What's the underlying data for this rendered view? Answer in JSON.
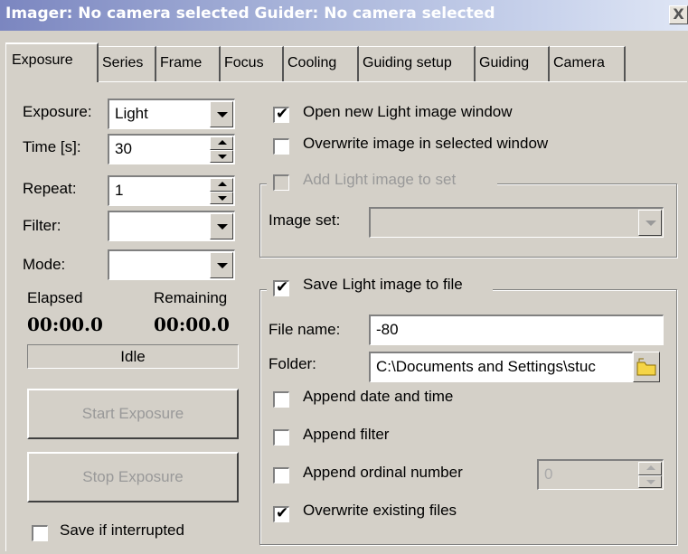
{
  "window": {
    "title": "Imager: No camera selected Guider: No camera selected",
    "close_glyph": "X"
  },
  "tabs": [
    {
      "label": "Exposure",
      "active": true
    },
    {
      "label": "Series"
    },
    {
      "label": "Frame"
    },
    {
      "label": "Focus"
    },
    {
      "label": "Cooling"
    },
    {
      "label": "Guiding setup"
    },
    {
      "label": "Guiding"
    },
    {
      "label": "Camera"
    }
  ],
  "left": {
    "exposure": {
      "label": "Exposure:",
      "value": "Light"
    },
    "time": {
      "label": "Time [s]:",
      "value": "30"
    },
    "repeat": {
      "label": "Repeat:",
      "value": "1"
    },
    "filter": {
      "label": "Filter:",
      "value": ""
    },
    "mode": {
      "label": "Mode:",
      "value": ""
    },
    "elapsed": {
      "label": "Elapsed",
      "value": "00:00.0"
    },
    "remaining": {
      "label": "Remaining",
      "value": "00:00.0"
    },
    "status": "Idle",
    "start_button": "Start Exposure",
    "stop_button": "Stop Exposure",
    "save_if_interrupted": {
      "label": "Save if interrupted",
      "checked": false
    }
  },
  "right": {
    "open_new_window": {
      "label": "Open new Light image window",
      "checked": true
    },
    "overwrite_selected": {
      "label": "Overwrite image in selected window",
      "checked": false
    },
    "add_to_set": {
      "label": "Add Light image to set",
      "checked": false,
      "disabled": true
    },
    "image_set": {
      "label": "Image set:",
      "value": ""
    },
    "save_to_file": {
      "label": "Save Light image to file",
      "checked": true
    },
    "file_name": {
      "label": "File name:",
      "value": "-80"
    },
    "folder": {
      "label": "Folder:",
      "value": "C:\\Documents and Settings\\stuc"
    },
    "append_date_time": {
      "label": "Append date and time",
      "checked": false
    },
    "append_filter": {
      "label": "Append filter",
      "checked": false
    },
    "append_ordinal": {
      "label": "Append ordinal number",
      "checked": false,
      "value": "0"
    },
    "overwrite_existing": {
      "label": "Overwrite existing files",
      "checked": true
    }
  },
  "icons": {
    "check": "✔",
    "folder": "folder-icon"
  },
  "colors": {
    "face": "#d4d0c8",
    "title_gradient_start": "#7b86c0"
  }
}
